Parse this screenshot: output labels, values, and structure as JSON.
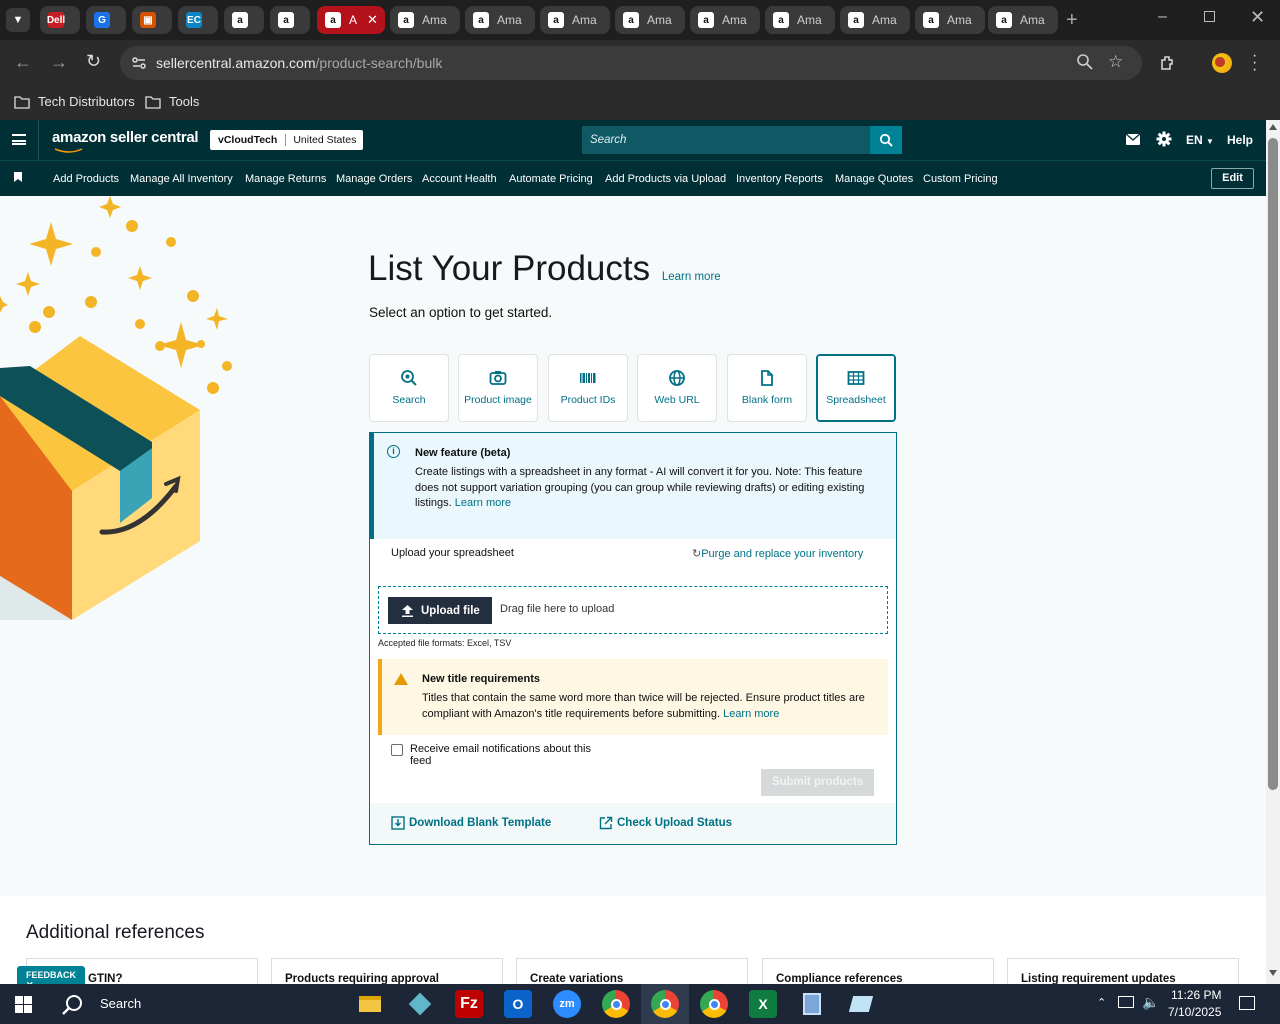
{
  "browser": {
    "tabs": [
      {
        "title": "",
        "favicon": "dell-icon"
      },
      {
        "title": "",
        "favicon": "g-icon"
      },
      {
        "title": "",
        "favicon": "box-icon"
      },
      {
        "title": "",
        "favicon": "ec-icon"
      },
      {
        "title": "",
        "favicon": "amazon-icon"
      },
      {
        "title": "",
        "favicon": "amazon-icon"
      },
      {
        "title": "A",
        "favicon": "amazon-icon",
        "active": true
      },
      {
        "title": "Ama",
        "favicon": "amazon-icon"
      },
      {
        "title": "Ama",
        "favicon": "amazon-icon"
      },
      {
        "title": "Ama",
        "favicon": "amazon-icon"
      },
      {
        "title": "Ama",
        "favicon": "amazon-icon"
      },
      {
        "title": "Ama",
        "favicon": "amazon-icon"
      },
      {
        "title": "Ama",
        "favicon": "amazon-icon"
      },
      {
        "title": "Ama",
        "favicon": "amazon-icon"
      },
      {
        "title": "Ama",
        "favicon": "amazon-icon"
      },
      {
        "title": "Ama",
        "favicon": "amazon-icon"
      }
    ],
    "url_host": "sellercentral.amazon.com",
    "url_path": "/product-search/bulk",
    "bookmarks": [
      "Tech Distributors",
      "Tools"
    ]
  },
  "header": {
    "logo_text": "amazon seller central",
    "store_name": "vCloudTech",
    "marketplace": "United States",
    "search_placeholder": "Search",
    "language": "EN",
    "help": "Help"
  },
  "nav": {
    "items": [
      "Add Products",
      "Manage All Inventory",
      "Manage Returns",
      "Manage Orders",
      "Account Health",
      "Automate Pricing",
      "Add Products via Upload",
      "Inventory Reports",
      "Manage Quotes",
      "Custom Pricing"
    ],
    "edit": "Edit"
  },
  "page": {
    "title": "List Your Products",
    "title_link": "Learn more",
    "subtitle": "Select an option to get started.",
    "options": [
      {
        "label": "Search",
        "icon": "search-icon"
      },
      {
        "label": "Product image",
        "icon": "camera-icon"
      },
      {
        "label": "Product IDs",
        "icon": "barcode-icon"
      },
      {
        "label": "Web URL",
        "icon": "globe-icon"
      },
      {
        "label": "Blank form",
        "icon": "document-icon"
      },
      {
        "label": "Spreadsheet",
        "icon": "spreadsheet-icon",
        "selected": true
      }
    ],
    "info": {
      "title": "New feature (beta)",
      "text": "Create listings with a spreadsheet in any format - AI will convert it for you. Note: This feature does not support variation grouping (you can group while reviewing drafts) or editing existing listings.",
      "link": "Learn more"
    },
    "upload_label": "Upload your spreadsheet",
    "purge_link": "Purge and replace your inventory",
    "upload_button": "Upload file",
    "drag_text": "Drag file here to upload",
    "accepted": "Accepted file formats: Excel, TSV",
    "warning": {
      "title": "New title requirements",
      "text": "Titles that contain the same word more than twice will be rejected. Ensure product titles are compliant with Amazon's title requirements before submitting.",
      "link": "Learn more"
    },
    "checkbox_label": "Receive email notifications about this feed",
    "submit": "Submit products",
    "download_template": "Download Blank Template",
    "check_status": "Check Upload Status"
  },
  "additional": {
    "heading": "Additional references",
    "cards": [
      "GTIN?",
      "Products requiring approval",
      "Create variations",
      "Compliance references",
      "Listing requirement updates"
    ],
    "feedback": "FEEDBACK"
  },
  "taskbar": {
    "search": "Search",
    "time": "11:26 PM",
    "date": "7/10/2025"
  },
  "colors": {
    "header_bg": "#002f36",
    "link": "#007185",
    "search_btn": "#008296"
  }
}
